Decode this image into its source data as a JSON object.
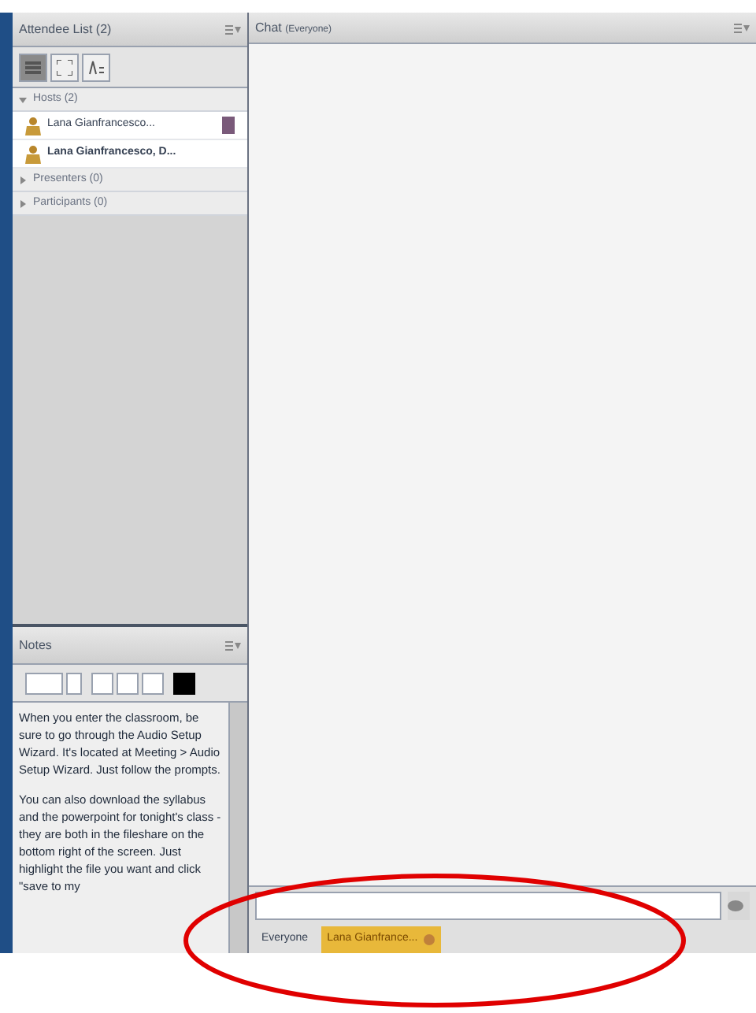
{
  "attendees": {
    "title": "Attendee List (2)",
    "view_buttons": [
      {
        "kind": "list",
        "selected": true
      },
      {
        "kind": "grid",
        "selected": false
      },
      {
        "kind": "sort",
        "selected": false
      }
    ],
    "groups": [
      {
        "label": "Hosts (2)",
        "expanded": true,
        "children": [
          {
            "name": "Lana Gianfrancesco...",
            "bold": false,
            "presenting": true
          },
          {
            "name": "Lana Gianfrancesco, D...",
            "bold": true,
            "presenting": false
          }
        ]
      },
      {
        "label": "Presenters (0)",
        "expanded": false
      },
      {
        "label": "Participants (0)",
        "expanded": false
      }
    ]
  },
  "notes": {
    "title": "Notes",
    "paragraphs": [
      "When you enter the classroom, be sure to go through the Audio Setup Wizard. It's located at Meeting > Audio Setup Wizard.  Just follow the prompts.",
      "You can also download the syllabus and the powerpoint for tonight's class - they are both in the fileshare on the bottom right of the screen. Just highlight the file you want and click \"save to my"
    ]
  },
  "chat": {
    "title": "Chat",
    "subtitle": "(Everyone)",
    "tabs": [
      {
        "label": "Everyone",
        "selected": false
      },
      {
        "label": "Lana Gianfrance...",
        "selected": true
      }
    ]
  }
}
